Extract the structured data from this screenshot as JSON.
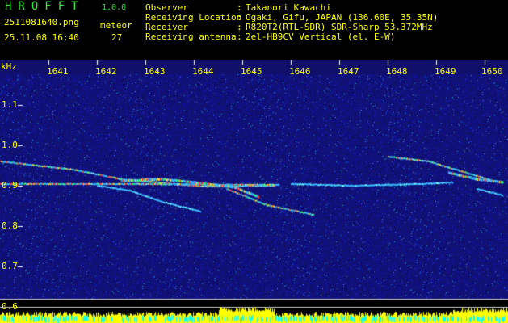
{
  "header": {
    "app_name": "HROFFT",
    "app_version": "1.0.0",
    "file_name": "2511081640.png",
    "meteor_label": "meteor",
    "datetime": "25.11.08 16:40",
    "meteor_count": "27",
    "info": [
      {
        "key": "Observer",
        "value": "Takanori Kawachi"
      },
      {
        "key": "Receiving Location",
        "value": "Ogaki, Gifu, JAPAN (136.60E, 35.35N)"
      },
      {
        "key": "Receiver",
        "value": "R820T2(RTL-SDR) SDR-Sharp 53.372MHz"
      },
      {
        "key": "Receiving antenna",
        "value": "2el-HB9CV Vertical (el. E-W)"
      }
    ]
  },
  "plot": {
    "y_unit": "kHz",
    "x_ticks": [
      "1641",
      "1642",
      "1643",
      "1644",
      "1645",
      "1646",
      "1647",
      "1648",
      "1649",
      "1650"
    ],
    "y_ticks": [
      "1.1",
      "1.0",
      "0.9",
      "0.8",
      "0.7",
      "0.6"
    ],
    "colors": {
      "background": "#10106a",
      "tick_text": "#ffff00",
      "power_fill": "#ffff00",
      "power_base": "#00ffff"
    }
  }
}
